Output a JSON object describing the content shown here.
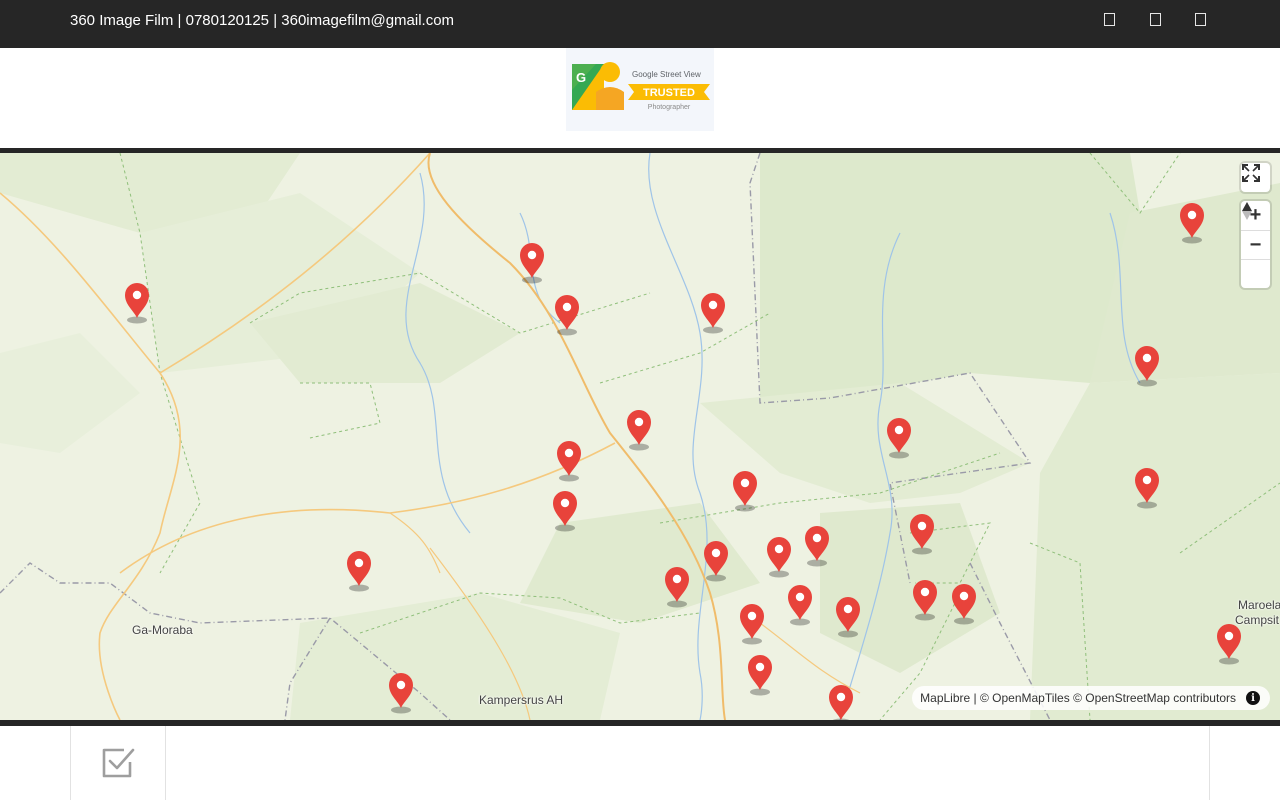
{
  "header": {
    "contact": "360 Image Film | 0780120125 | 360imagefilm@gmail.com",
    "social_icons": [
      "social-icon-1",
      "social-icon-2",
      "social-icon-3"
    ]
  },
  "badge": {
    "brand": "Google Street View",
    "ribbon": "TRUSTED",
    "subtitle": "Photographer"
  },
  "map": {
    "places": [
      "Ga-Moraba",
      "Kampersrus AH",
      "Maroela",
      "Campsit"
    ],
    "attribution": "MapLibre | © OpenMapTiles © OpenStreetMap contributors",
    "controls": [
      "fullscreen",
      "zoom-in",
      "zoom-out",
      "reset-north"
    ],
    "marker_count": 31,
    "colors": {
      "marker": "#e8433b",
      "land": "#eef2e2",
      "forest": "#dfeacf",
      "road": "#f5c97e",
      "river": "#9fc4e8"
    }
  },
  "footer": {
    "icon": "checkbox-icon"
  }
}
